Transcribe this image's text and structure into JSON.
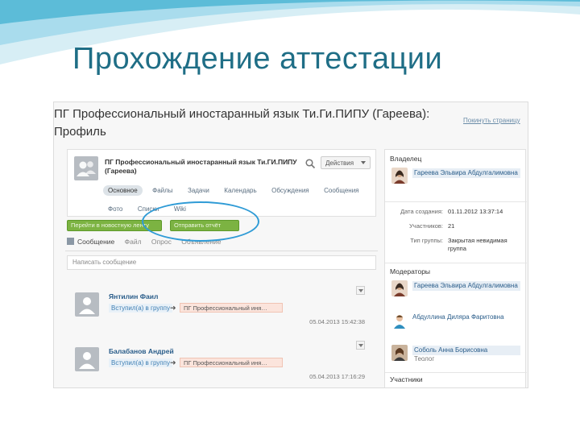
{
  "slide": {
    "title": "Прохождение аттестации"
  },
  "app": {
    "page_title": "ПГ Профессиональный иностаранный язык Ти.Ги.ПИПУ (Гареева): Профиль",
    "header_link": "Покинуть страницу"
  },
  "profile": {
    "name": "ПГ Профессиональный иностаранный язык Ти.ГИ.ПИПУ (Гареева)",
    "actions_label": "Действия",
    "tabs": [
      "Основное",
      "Файлы",
      "Задачи",
      "Календарь",
      "Обсуждения",
      "Сообщения",
      "Фото",
      "Списки",
      "Wiki"
    ],
    "active_tab": 0
  },
  "buttons": {
    "primary": "Перейти в новостную ленту",
    "secondary": "Отправить отчёт"
  },
  "composer": {
    "tools": [
      "Сообщение",
      "Файл",
      "Опрос",
      "Объявление"
    ],
    "placeholder": "Написать сообщение"
  },
  "feed": [
    {
      "name": "Янтилин Фаил",
      "action": "Вступил(а) в группу",
      "group": "ПГ Профессиональный иня…",
      "date": "05.04.2013 15:42:38"
    },
    {
      "name": "Балабанов Андрей",
      "action": "Вступил(а) в группу",
      "group": "ПГ Профессиональный иня…",
      "date": "05.04.2013 17:16:29"
    }
  ],
  "sidebar": {
    "owner_heading": "Владелец",
    "owner": "Гареева Эльвира Абдулгалимовна",
    "info": [
      {
        "key": "Дата создания:",
        "value": "01.11.2012 13:37:14"
      },
      {
        "key": "Участников:",
        "value": "21"
      },
      {
        "key": "Тип группы:",
        "value": "Закрытая невидимая группа"
      }
    ],
    "moderators_heading": "Модераторы",
    "moderators": [
      "Гареева Эльвира Абдулгалимовна",
      "Абдуллина Диляра Фаритовна",
      "Соболь Анна Борисовна"
    ],
    "moderator_note": "Теолог",
    "members_heading": "Участники"
  },
  "colors": {
    "title": "#1f6e86",
    "accent_green": "#7cb342",
    "highlight_ring": "#2f9bd6",
    "link": "#2a5d8a"
  }
}
